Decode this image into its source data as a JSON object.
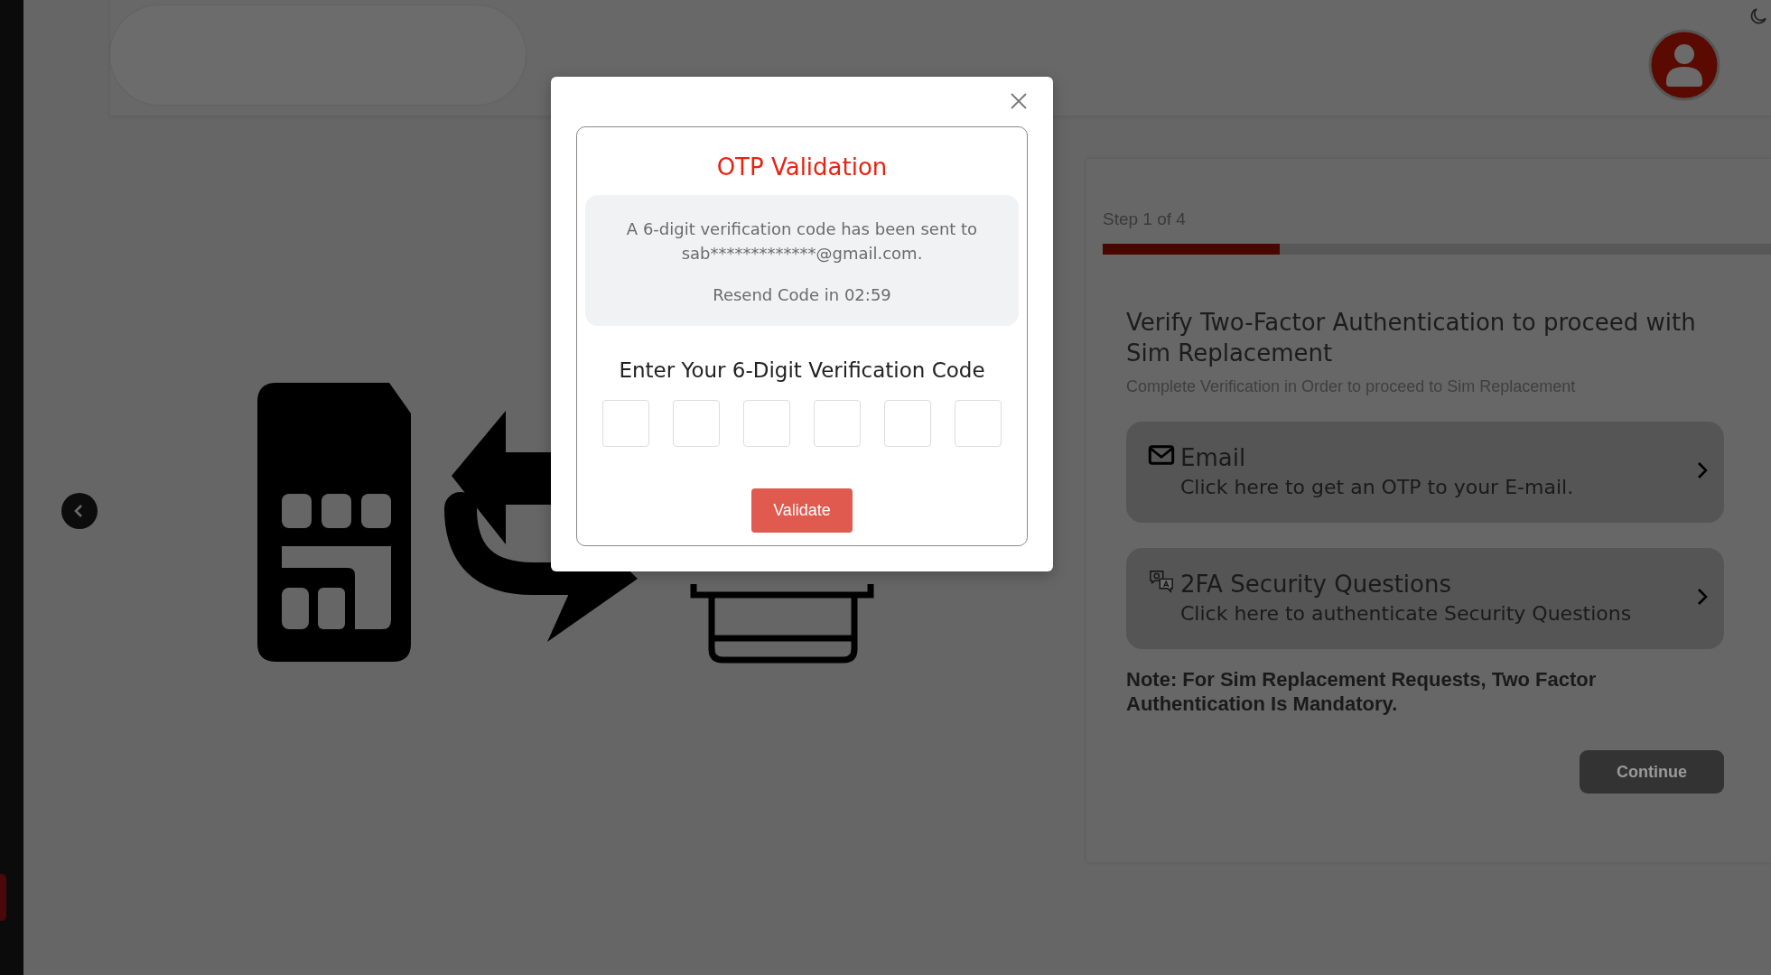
{
  "wizard": {
    "step_label": "Step 1 of 4",
    "progress": {
      "level": 0.265
    },
    "heading": "Verify Two-Factor Authentication to proceed with Sim Replacement",
    "subtitle": "Complete Verification in Order to proceed to Sim Replacement",
    "options": [
      {
        "kind": "email",
        "title": "Email",
        "description": "Click here to get an OTP to your E-mail."
      },
      {
        "kind": "questions",
        "title": "2FA Security Questions",
        "description": "Click here to authenticate Security Questions"
      }
    ],
    "note": "Note: For Sim Replacement Requests, Two Factor Authentication Is Mandatory.",
    "continue_button": "Continue"
  },
  "modal": {
    "title": "OTP Validation",
    "message": "A 6-digit verification code has been sent to sab*************@gmail.com.",
    "resend": "Resend Code in 02:59",
    "code_label": "Enter Your 6-Digit Verification Code",
    "code_fields": [
      {
        "filled": false
      },
      {
        "filled": false
      },
      {
        "filled": false
      },
      {
        "filled": false
      },
      {
        "filled": false
      },
      {
        "filled": false
      }
    ],
    "validate_button": "Validate"
  }
}
